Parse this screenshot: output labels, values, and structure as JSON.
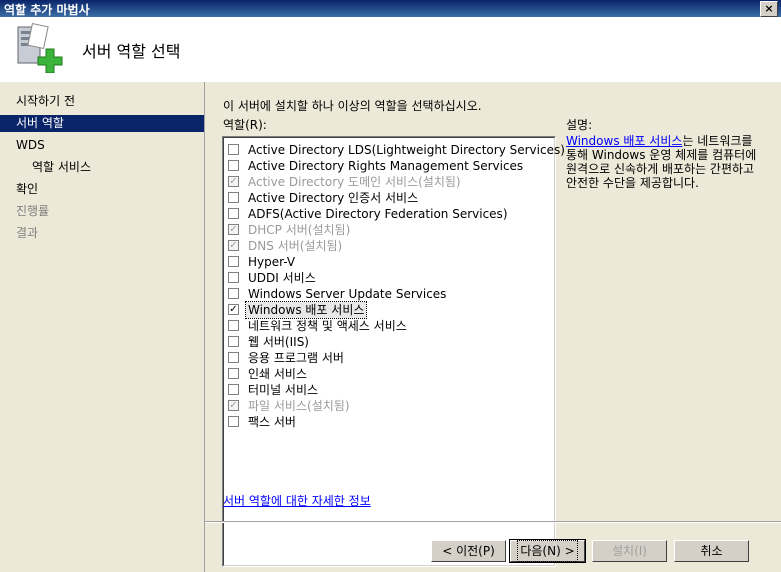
{
  "window": {
    "title": "역할 추가 마법사",
    "close": "×"
  },
  "header": {
    "title": "서버 역할 선택"
  },
  "nav": [
    {
      "label": "시작하기 전",
      "state": "normal"
    },
    {
      "label": "서버 역할",
      "state": "selected"
    },
    {
      "label": "WDS",
      "state": "normal"
    },
    {
      "label": "역할 서비스",
      "state": "sub"
    },
    {
      "label": "확인",
      "state": "normal"
    },
    {
      "label": "진행률",
      "state": "disabled"
    },
    {
      "label": "결과",
      "state": "disabled"
    }
  ],
  "main": {
    "instruction": "이 서버에 설치할 하나 이상의 역할을 선택하십시오.",
    "roles_label": "역할(R):",
    "roles": [
      {
        "label": "Active Directory LDS(Lightweight Directory Services)",
        "checked": false,
        "installed": false
      },
      {
        "label": "Active Directory Rights Management Services",
        "checked": false,
        "installed": false
      },
      {
        "label": "Active Directory 도메인 서비스(설치됨)",
        "checked": true,
        "installed": true
      },
      {
        "label": "Active Directory 인증서 서비스",
        "checked": false,
        "installed": false
      },
      {
        "label": "ADFS(Active Directory Federation Services)",
        "checked": false,
        "installed": false
      },
      {
        "label": "DHCP 서버(설치됨)",
        "checked": true,
        "installed": true
      },
      {
        "label": "DNS 서버(설치됨)",
        "checked": true,
        "installed": true
      },
      {
        "label": "Hyper-V",
        "checked": false,
        "installed": false
      },
      {
        "label": "UDDI 서비스",
        "checked": false,
        "installed": false
      },
      {
        "label": "Windows Server Update Services",
        "checked": false,
        "installed": false
      },
      {
        "label": "Windows 배포 서비스",
        "checked": true,
        "installed": false,
        "focus": true
      },
      {
        "label": "네트워크 정책 및 액세스 서비스",
        "checked": false,
        "installed": false
      },
      {
        "label": "웹 서버(IIS)",
        "checked": false,
        "installed": false
      },
      {
        "label": "응용 프로그램 서버",
        "checked": false,
        "installed": false
      },
      {
        "label": "인쇄 서비스",
        "checked": false,
        "installed": false
      },
      {
        "label": "터미널 서비스",
        "checked": false,
        "installed": false
      },
      {
        "label": "파일 서비스(설치됨)",
        "checked": true,
        "installed": true
      },
      {
        "label": "팩스 서버",
        "checked": false,
        "installed": false
      }
    ],
    "description_title": "설명:",
    "description_link": "Windows 배포 서비스",
    "description_text": "는 네트워크를 통해 Windows 운영 체제를 컴퓨터에 원격으로 신속하게 배포하는 간편하고 안전한 수단을 제공합니다.",
    "more_info_link": "서버 역할에 대한 자세한 정보"
  },
  "buttons": {
    "back": "< 이전(P)",
    "next": "다음(N) >",
    "install": "설치(I)",
    "cancel": "취소"
  }
}
